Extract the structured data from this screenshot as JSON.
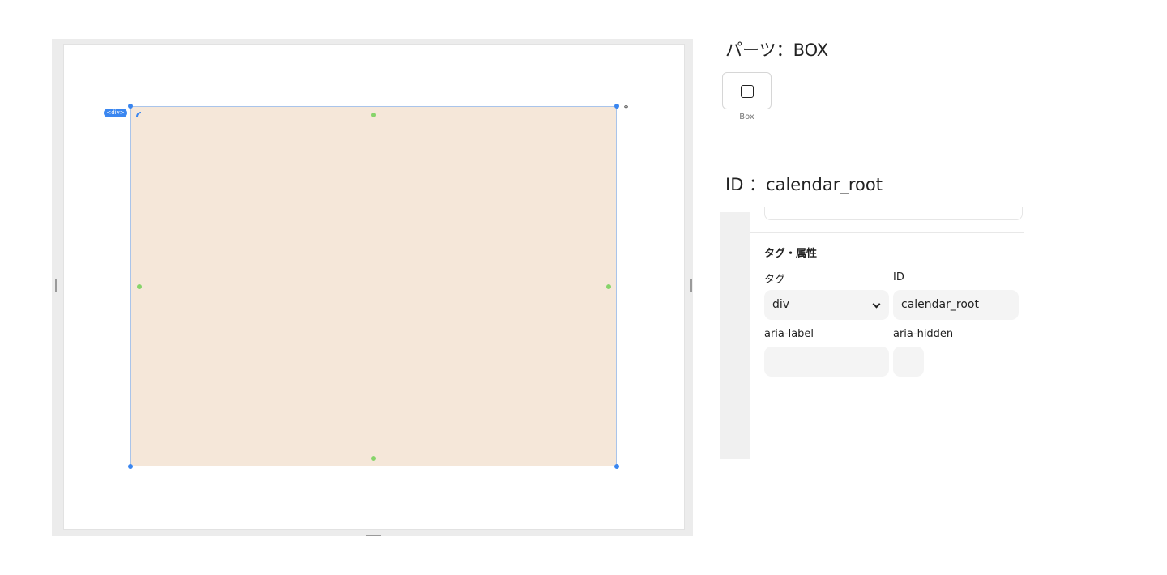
{
  "canvas": {
    "element_badge": "<div>",
    "link_icon": "link-icon"
  },
  "parts_panel": {
    "heading": "パーツ：BOX",
    "tiles": [
      {
        "label": "Box",
        "icon": "square-icon"
      }
    ]
  },
  "id_heading": "ID ：calendar_root",
  "properties": {
    "section_title": "タグ・属性",
    "tag_label": "タグ",
    "tag_value": "div",
    "id_label": "ID",
    "id_value": "calendar_root",
    "aria_label_label": "aria-label",
    "aria_label_value": "",
    "aria_hidden_label": "aria-hidden",
    "aria_hidden_value": ""
  },
  "colors": {
    "selection_blue": "#3a86f0",
    "box_fill": "#f5e7d9",
    "midpoint_green": "#86d46a"
  }
}
